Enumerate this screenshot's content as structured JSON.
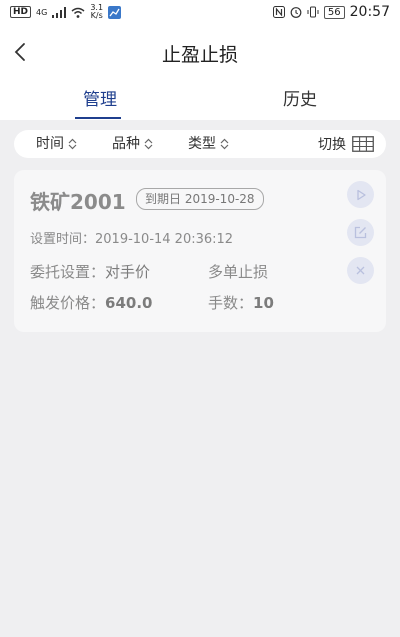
{
  "status_bar": {
    "hd": "HD",
    "network": "4G",
    "speed_value": "3.1",
    "speed_unit": "K/s",
    "battery": "56",
    "time": "20:57"
  },
  "header": {
    "title": "止盈止损"
  },
  "tabs": [
    {
      "label": "管理",
      "active": true
    },
    {
      "label": "历史",
      "active": false
    }
  ],
  "filters": {
    "time": "时间",
    "variety": "品种",
    "type": "类型",
    "switch": "切换"
  },
  "order": {
    "name": "铁矿2001",
    "expiry": "到期日 2019-10-28",
    "set_time": "设置时间：2019-10-14 20:36:12",
    "entrust_label": "委托设置：",
    "entrust_value": "对手价",
    "multi": "多单止损",
    "trigger_label": "触发价格：",
    "trigger_value": "640.0",
    "qty_label": "手数：",
    "qty_value": "10"
  },
  "colors": {
    "accent": "#1f3f8e",
    "background": "#efeff1",
    "card": "#f7f7f8",
    "action_bg": "#e3e6f2",
    "action_icon": "#b9c0de"
  }
}
